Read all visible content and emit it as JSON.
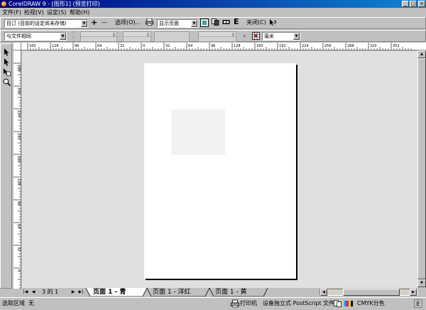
{
  "window": {
    "title": "CorelDRAW 9 - [图形1] (预览打印)"
  },
  "menu": [
    "文件(F)",
    "检视(V)",
    "设定(S)",
    "帮助(H)"
  ],
  "toolbar1": {
    "preset_value": "目订 (目前的设定尚未存储)",
    "add_label": "+",
    "remove_label": "—",
    "options_label": "选项(O)...",
    "view_value": "显示页面",
    "close_label": "关闭(C)",
    "e_label": "E"
  },
  "toolbar2": {
    "position_value": "与文件相同",
    "units_value": "毫米"
  },
  "hruler_labels": [
    "160",
    "128",
    "96",
    "64",
    "32",
    "0",
    "32",
    "64",
    "96",
    "128",
    "160",
    "192",
    "224",
    "256",
    "288",
    "320",
    "352"
  ],
  "vruler_labels": [
    "288",
    "256",
    "224",
    "192",
    "160",
    "128",
    "96",
    "64",
    "32",
    "0"
  ],
  "page_tabs": {
    "counter": "3 的 1",
    "tabs": [
      "页面 1 - 青",
      "页面 1 - 洋红",
      "页面 1 - 黄"
    ]
  },
  "status": {
    "selection_label": "选取区域",
    "selection_value": "无",
    "printer_label": "打印机",
    "printer_value": "设备独立式 PostScript 文件",
    "color_mode": "CMYK分色"
  }
}
